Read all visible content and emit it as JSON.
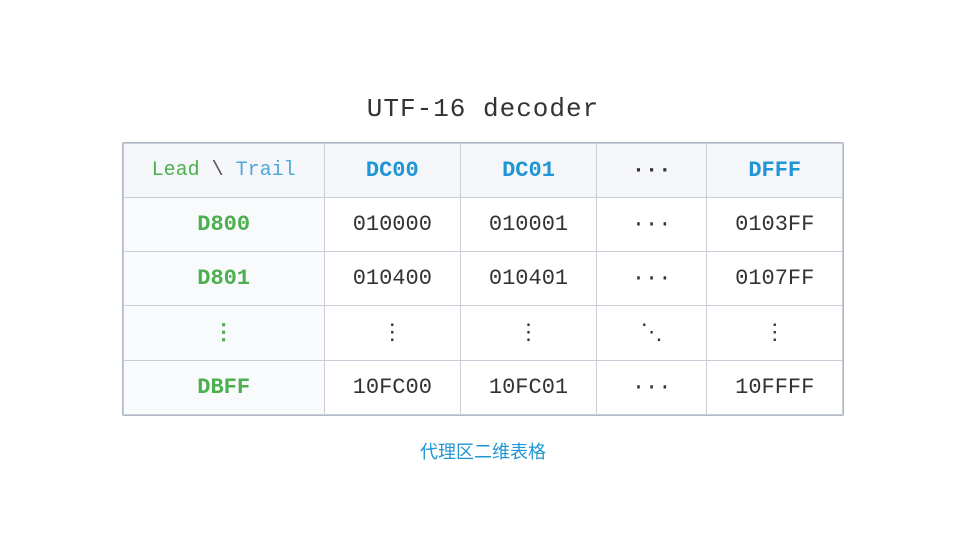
{
  "title": "UTF-16 decoder",
  "caption": "代理区二维表格",
  "header": {
    "lead_trail_label": "Lead",
    "lead_trail_sep": " \\ ",
    "lead_trail_trail": "Trail",
    "col1": "DC00",
    "col2": "DC01",
    "col3": "···",
    "col4": "DFFF"
  },
  "rows": [
    {
      "row_header": "D800",
      "col1": "010000",
      "col2": "010001",
      "col3": "···",
      "col4": "0103FF"
    },
    {
      "row_header": "D801",
      "col1": "010400",
      "col2": "010401",
      "col3": "···",
      "col4": "0107FF"
    },
    {
      "row_header": "⋮",
      "col1": "⋮",
      "col2": "⋮",
      "col3": "⋱",
      "col4": "⋮"
    },
    {
      "row_header": "DBFF",
      "col1": "10FC00",
      "col2": "10FC01",
      "col3": "···",
      "col4": "10FFFF"
    }
  ]
}
